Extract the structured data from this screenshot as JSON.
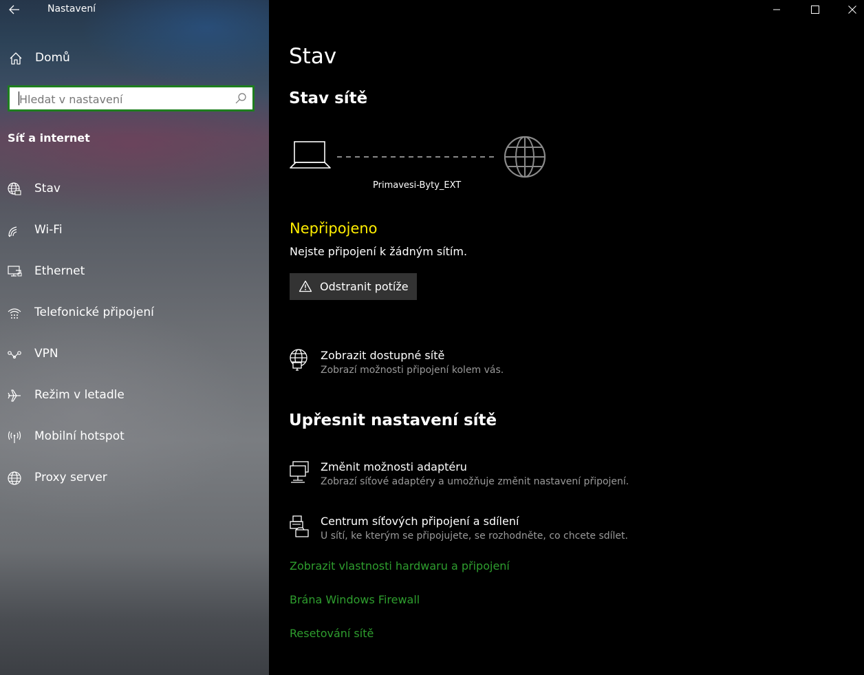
{
  "window": {
    "app_title": "Nastavení"
  },
  "sidebar": {
    "home_label": "Domů",
    "search_placeholder": "Hledat v nastavení",
    "section_title": "Síť a internet",
    "items": [
      {
        "label": "Stav",
        "icon": "globe-status-icon"
      },
      {
        "label": "Wi-Fi",
        "icon": "wifi-icon"
      },
      {
        "label": "Ethernet",
        "icon": "ethernet-icon"
      },
      {
        "label": "Telefonické připojení",
        "icon": "dialup-icon"
      },
      {
        "label": "VPN",
        "icon": "vpn-icon"
      },
      {
        "label": "Režim v letadle",
        "icon": "airplane-icon"
      },
      {
        "label": "Mobilní hotspot",
        "icon": "hotspot-icon"
      },
      {
        "label": "Proxy server",
        "icon": "globe-icon"
      }
    ]
  },
  "main": {
    "page_title": "Stav",
    "network_status_heading": "Stav sítě",
    "network_name": "Primavesi-Byty_EXT",
    "status_title": "Nepřipojeno",
    "status_description": "Nejste připojení k žádným sítím.",
    "troubleshoot_label": "Odstranit potíže",
    "show_networks": {
      "title": "Zobrazit dostupné sítě",
      "subtitle": "Zobrazí možnosti připojení kolem vás."
    },
    "advanced_heading": "Upřesnit nastavení sítě",
    "adapter_options": {
      "title": "Změnit možnosti adaptéru",
      "subtitle": "Zobrazí síťové adaptéry a umožňuje změnit nastavení připojení."
    },
    "sharing_center": {
      "title": "Centrum síťových připojení a sdílení",
      "subtitle": "U sítí, ke kterým se připojujete, se rozhodněte, co chcete sdílet."
    },
    "links": [
      "Zobrazit vlastnosti hardwaru a připojení",
      "Brána Windows Firewall",
      "Resetování sítě"
    ]
  },
  "colors": {
    "status_warning": "#ffee00",
    "link_green": "#2e9e2e",
    "search_border": "#1e7f1e",
    "button_bg": "#333333"
  }
}
